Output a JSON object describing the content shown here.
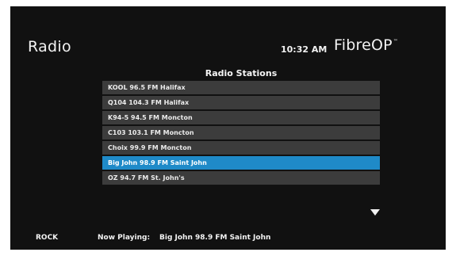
{
  "header": {
    "title": "Radio",
    "time": "10:32 AM",
    "brand": "FibreOP",
    "brand_mark": "™"
  },
  "list": {
    "title": "Radio Stations",
    "stations": [
      {
        "label": "KOOL 96.5 FM Halifax",
        "selected": false
      },
      {
        "label": "Q104 104.3 FM Halifax",
        "selected": false
      },
      {
        "label": "K94-5 94.5 FM Moncton",
        "selected": false
      },
      {
        "label": "C103 103.1 FM Moncton",
        "selected": false
      },
      {
        "label": "Choix 99.9 FM Moncton",
        "selected": false
      },
      {
        "label": "Big John 98.9 FM Saint John",
        "selected": true
      },
      {
        "label": "OZ 94.7 FM St. John's",
        "selected": false
      }
    ],
    "scroll_icon": "triangle-down-icon"
  },
  "footer": {
    "genre": "ROCK",
    "now_playing_label": "Now Playing:",
    "now_playing_value": "Big John 98.9 FM Saint John"
  },
  "colors": {
    "background": "#111111",
    "row": "#3c3c3c",
    "selected_row": "#1f8ac8",
    "text": "#f2f2f2"
  }
}
